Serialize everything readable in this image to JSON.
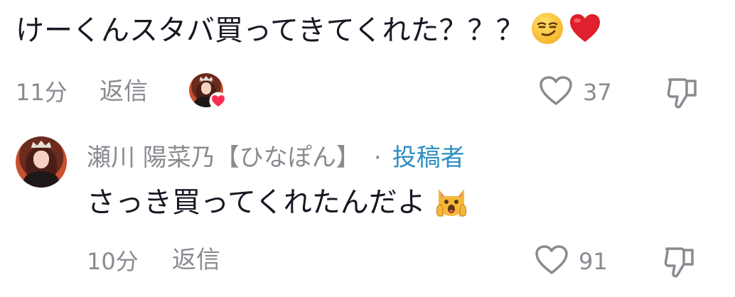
{
  "comment1": {
    "text": "けーくんスタバ買ってきてくれた？？？",
    "emojis": [
      "smirking-face",
      "red-heart"
    ],
    "time": "11分",
    "reply_label": "返信",
    "likes": "37",
    "liked_by_creator": true
  },
  "comment2": {
    "username": "瀬川 陽菜乃【ひなぽん】",
    "separator": "·",
    "author_badge": "投稿者",
    "text": "さっき買ってくれたんだよ",
    "emojis": [
      "weary-cat-face"
    ],
    "time": "10分",
    "reply_label": "返信",
    "likes": "91"
  },
  "colors": {
    "text": "#161823",
    "muted": "#8a8b91",
    "author_badge": "#2d8fc0",
    "heart": "#fe2c55"
  }
}
